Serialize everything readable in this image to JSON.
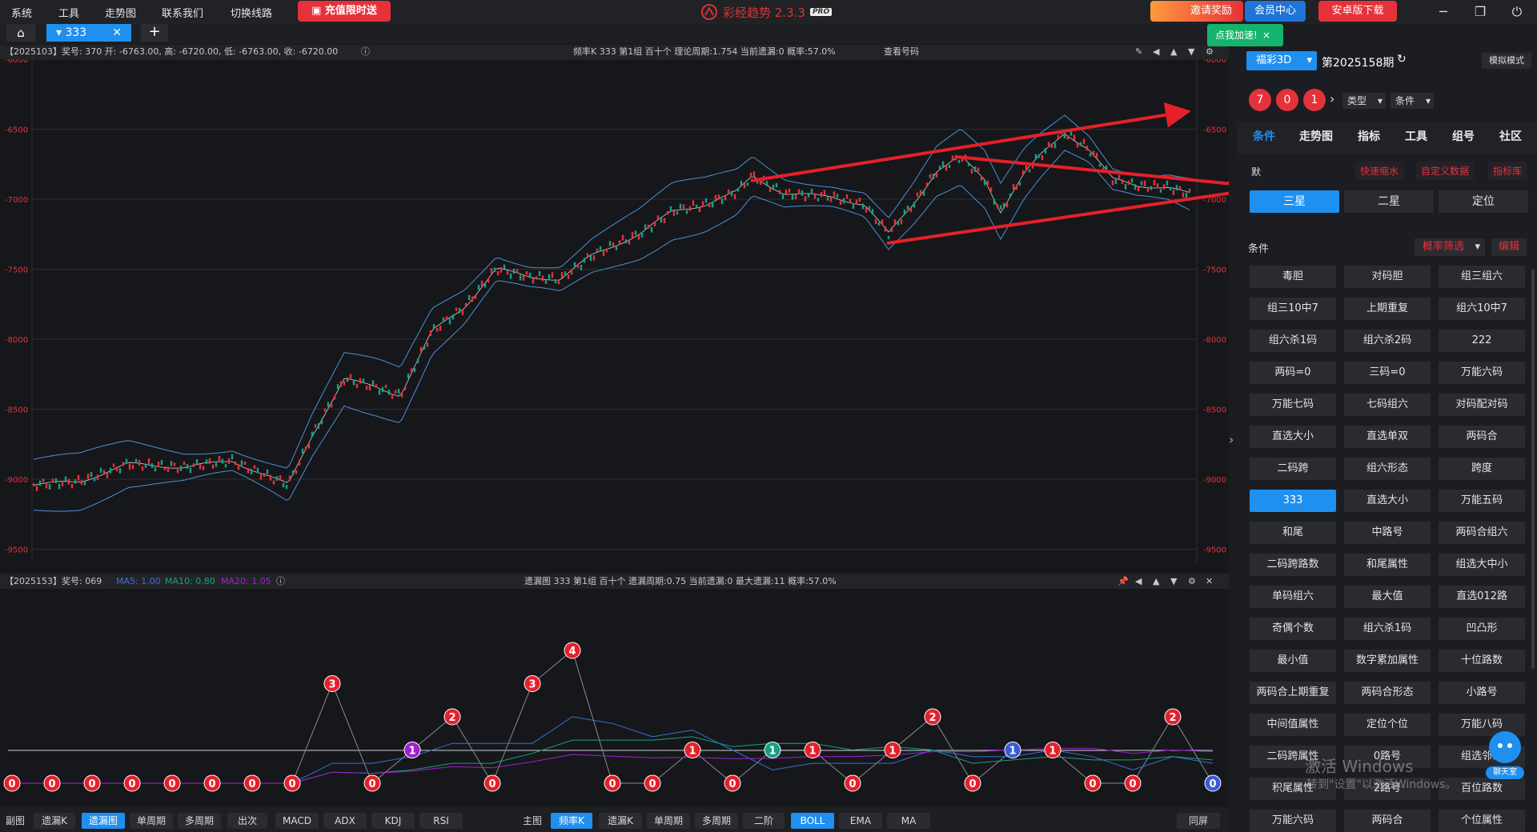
{
  "menu": [
    "系统",
    "工具",
    "走势图",
    "联系我们",
    "切换线路"
  ],
  "recharge_label": "充值限时送",
  "app_title": "彩经趋势 2.3.3",
  "pro_badge": "PRO",
  "invite_label": "邀请奖励",
  "member_label": "会员中心",
  "android_label": "安卓版下载",
  "speedup_label": "点我加速!",
  "tab": {
    "label": "333"
  },
  "kline": {
    "info_left": "【2025103】奖号: 370  开: -6763.00, 高: -6720.00, 低: -6763.00, 收: -6720.00",
    "info_center": "频率K  333  第1组  百十个  理论周期:1.754  当前遗漏:0  概率:57.0%",
    "view_number": "查看号码",
    "y_ticks": [
      "-6000",
      "-6500",
      "-7000",
      "-7500",
      "-8000",
      "-8500",
      "-9000",
      "-9500"
    ],
    "trend_colors": {
      "up": "#e5323a",
      "down": "#16a085",
      "band": "#4a90d9",
      "arrow": "#e5202a"
    }
  },
  "miss": {
    "info_left": "【2025153】奖号: 069",
    "ma5": "MA5: 1.00",
    "ma10": "MA10: 0.80",
    "ma20": "MA20: 1.05",
    "info_center": "遗漏图  333  第1组  百十个  遗漏周期:0.75  当前遗漏:0  最大遗漏:11  概率:57.0%",
    "points": [
      0,
      0,
      0,
      0,
      0,
      0,
      0,
      0,
      3,
      0,
      1,
      2,
      0,
      3,
      4,
      0,
      0,
      1,
      0,
      1,
      1,
      0,
      1,
      2,
      0,
      1,
      1,
      0,
      0,
      2,
      0
    ],
    "special": {
      "10": "#a020d0",
      "19": "#16a085",
      "25": "#3a5bd9",
      "30": "#3a5bd9"
    }
  },
  "bottom_left": [
    "副图",
    "遗漏K",
    "遗漏图",
    "单周期",
    "多周期",
    "出次",
    "MACD",
    "ADX",
    "KDJ",
    "RSI"
  ],
  "bottom_left_active": "遗漏图",
  "bottom_mid": [
    "主图",
    "频率K",
    "遗漏K",
    "单周期",
    "多周期",
    "二阶",
    "BOLL",
    "EMA",
    "MA"
  ],
  "bottom_mid_active": [
    "频率K",
    "BOLL"
  ],
  "split_screen": "同屏",
  "right": {
    "lottery": "福彩3D",
    "period": "第2025158期",
    "simulate": "模拟模式",
    "balls": [
      "7",
      "0",
      "1"
    ],
    "type_select": "类型",
    "cond_select": "条件",
    "tabs": [
      "条件",
      "走势图",
      "指标",
      "工具",
      "组号",
      "社区"
    ],
    "hidden_label": "默",
    "links": [
      "快速缩水",
      "自定义数据",
      "指标库"
    ],
    "segments": [
      "三星",
      "二星",
      "定位"
    ],
    "cond_label": "条件",
    "filter": "概率筛选",
    "edit": "编辑",
    "conditions": [
      "毒胆",
      "对码胆",
      "组三组六",
      "组三10中7",
      "上期重复",
      "组六10中7",
      "组六杀1码",
      "组六杀2码",
      "222",
      "两码=0",
      "三码=0",
      "万能六码",
      "万能七码",
      "七码组六",
      "对码配对码",
      "直选大小",
      "直选单双",
      "两码合",
      "二码跨",
      "组六形态",
      "跨度",
      "333",
      "直选大小",
      "万能五码",
      "和尾",
      "中路号",
      "两码合组六",
      "二码跨路数",
      "和尾属性",
      "组选大中小",
      "单码组六",
      "最大值",
      "直选012路",
      "奇偶个数",
      "组六杀1码",
      "凹凸形",
      "最小值",
      "数字累加属性",
      "十位路数",
      "两码合上期重复",
      "两码合形态",
      "小路号",
      "中间值属性",
      "定位个位",
      "万能八码",
      "二码跨属性",
      "0路号",
      "组选邻码",
      "积尾属性",
      "2路号",
      "百位路数",
      "万能六码",
      "两码合",
      "个位属性"
    ],
    "active_condition": "333",
    "watermark_1": "激活 Windows",
    "watermark_2": "转到\"设置\"以激活Windows。",
    "chat": "聊天室"
  }
}
